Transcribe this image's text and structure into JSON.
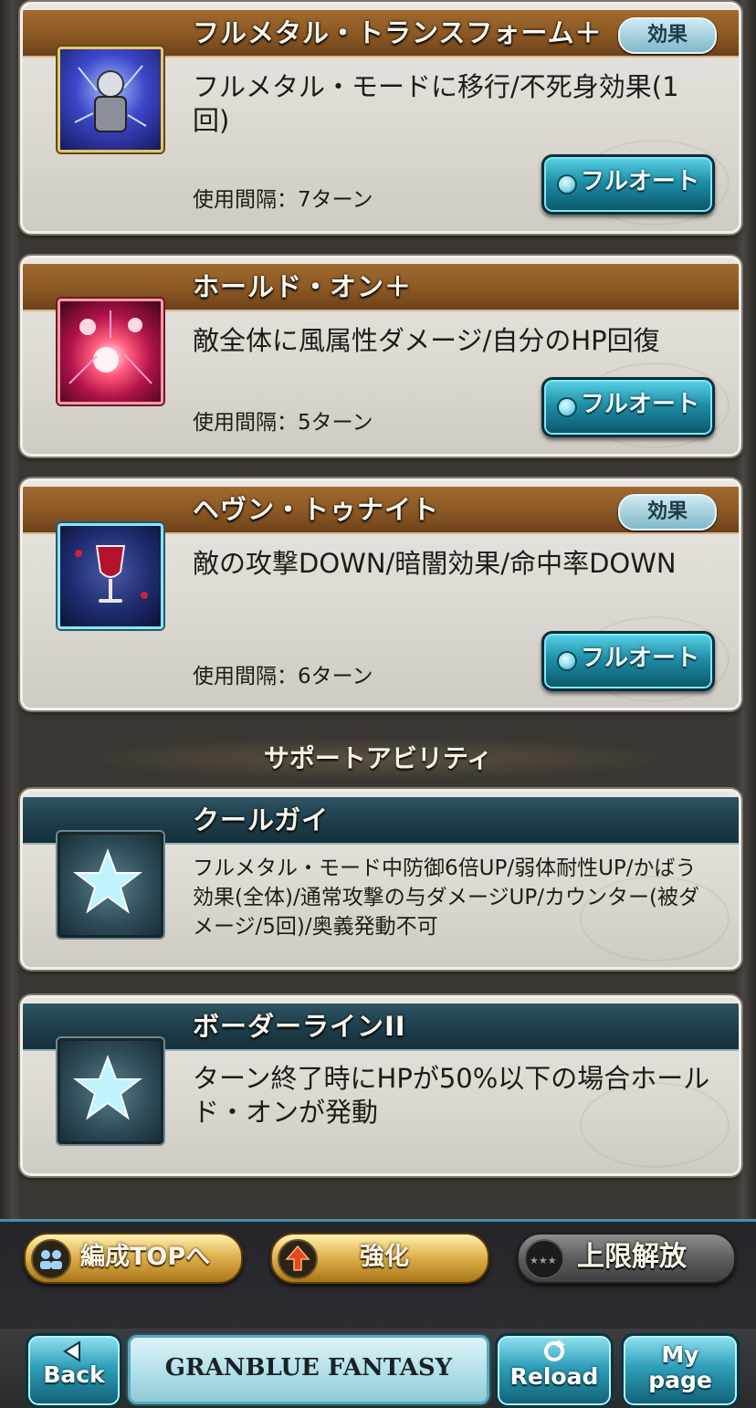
{
  "abilities": [
    {
      "name": "フルメタル・トランスフォーム＋",
      "effect_badge": "効果",
      "description": "フルメタル・モードに移行/不死身効果(1回)",
      "cooldown": "使用間隔：7ターン",
      "full_auto_label": "フルオート",
      "icon": "armored-knight-icon"
    },
    {
      "name": "ホールド・オン＋",
      "effect_badge": "",
      "description": "敵全体に風属性ダメージ/自分のHP回復",
      "cooldown": "使用間隔：5ターン",
      "full_auto_label": "フルオート",
      "icon": "red-burst-icon"
    },
    {
      "name": "ヘヴン・トゥナイト",
      "effect_badge": "効果",
      "description": "敵の攻撃DOWN/暗闇効果/命中率DOWN",
      "cooldown": "使用間隔：6ターン",
      "full_auto_label": "フルオート",
      "icon": "wine-glass-icon"
    }
  ],
  "support_section_title": "サポートアビリティ",
  "support_abilities": [
    {
      "name": "クールガイ",
      "description": "フルメタル・モード中防御6倍UP/弱体耐性UP/かばう効果(全体)/通常攻撃の与ダメージUP/カウンター(被ダメージ/5回)/奥義発動不可",
      "icon": "star-icon"
    },
    {
      "name": "ボーダーラインII",
      "description": "ターン終了時にHPが50%以下の場合ホールド・オンが発動",
      "icon": "star-icon"
    }
  ],
  "actions": {
    "party_top": "編成TOPへ",
    "enhance": "強化",
    "uncap": "上限解放"
  },
  "nav": {
    "back": "Back",
    "logo": "GRANBLUE FANTASY",
    "reload": "Reload",
    "my_page_1": "My",
    "my_page_2": "page"
  },
  "colors": {
    "ability_header": "#8b5824",
    "support_header": "#1d3d49",
    "full_auto_button": "#1f8fa8",
    "gold_button": "#e2b450"
  }
}
